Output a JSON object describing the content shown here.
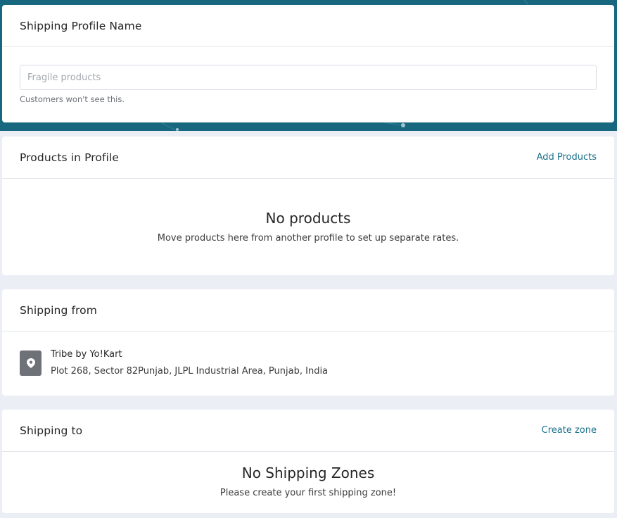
{
  "profile_name": {
    "title": "Shipping Profile Name",
    "input_placeholder": "Fragile products",
    "input_value": "",
    "hint": "Customers won't see this."
  },
  "products": {
    "title": "Products in Profile",
    "action": "Add Products",
    "empty_title": "No products",
    "empty_subtitle": "Move products here from another profile to set up separate rates."
  },
  "shipping_from": {
    "title": "Shipping from",
    "location_icon": "map-pin-icon",
    "location_name": "Tribe by Yo!Kart",
    "location_address": "Plot 268, Sector 82Punjab, JLPL Industrial Area, Punjab, India"
  },
  "shipping_to": {
    "title": "Shipping to",
    "action": "Create zone",
    "empty_title": "No Shipping Zones",
    "empty_subtitle": "Please create your first shipping zone!"
  },
  "colors": {
    "hero_background": "#17677f",
    "link": "#19708a",
    "page_background": "#eceef6",
    "pin_box": "#6e7178"
  }
}
